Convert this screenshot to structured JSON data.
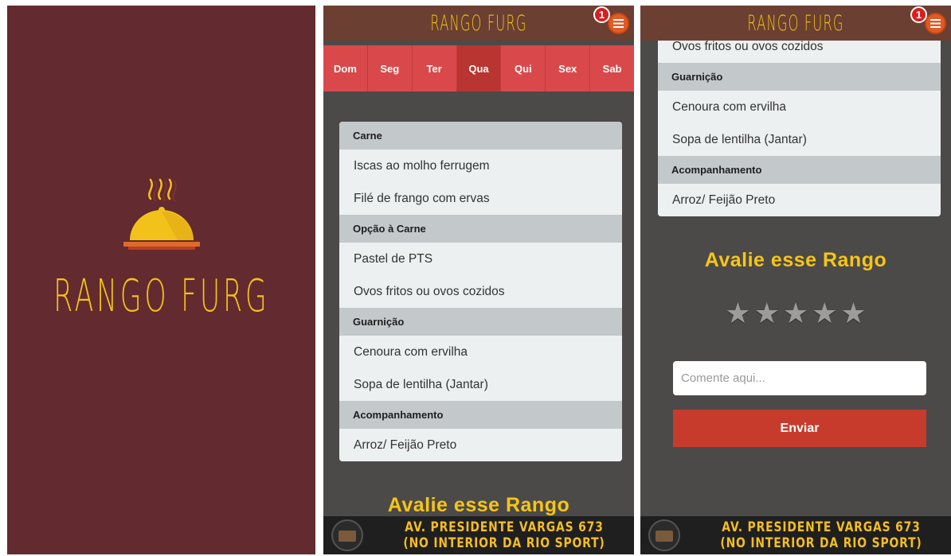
{
  "app": {
    "title": "RANGO FURG",
    "notification_count": "1"
  },
  "splash": {
    "title": "RANGO FURG"
  },
  "days": [
    "Dom",
    "Seg",
    "Ter",
    "Qua",
    "Qui",
    "Sex",
    "Sab"
  ],
  "selected_day": "Qua",
  "menu": {
    "carne_label": "Carne",
    "carne_items": [
      "Iscas ao molho ferrugem",
      "Filé de frango com ervas"
    ],
    "opcao_label": "Opção à Carne",
    "opcao_items": [
      "Pastel de PTS",
      "Ovos fritos ou ovos cozidos"
    ],
    "guarnicao_label": "Guarnição",
    "guarnicao_items": [
      "Cenoura com ervilha",
      "Sopa de lentilha (Jantar)"
    ],
    "acompanhamento_label": "Acompanhamento",
    "acompanhamento_items": [
      "Arroz/ Feijão Preto"
    ]
  },
  "rating": {
    "title": "Avalie esse Rango",
    "stars_total": 5,
    "stars_selected": 0,
    "comment_placeholder": "Comente aqui...",
    "submit_label": "Enviar"
  },
  "ad": {
    "line1": "AV. PRESIDENTE VARGAS 673",
    "line2": "(NO INTERIOR DA RIO SPORT)"
  },
  "colors": {
    "splash_bg": "#632a2f",
    "accent_yellow": "#f3c21a",
    "day_bar": "#d9494b",
    "day_active": "#b93531",
    "send_button": "#c73b2d"
  }
}
